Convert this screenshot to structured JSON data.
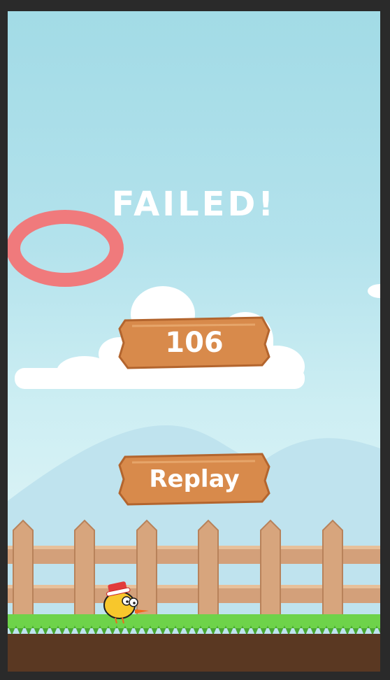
{
  "status": {
    "title": "FAILED!"
  },
  "score": {
    "value": "106"
  },
  "replay_button": {
    "label": "Replay"
  },
  "colors": {
    "sky_top": "#a2dbe6",
    "ring": "#f07a7c",
    "wood": "#d88a4b",
    "fence": "#d3a07a",
    "grass": "#6ed34a",
    "dirt": "#5a3822"
  },
  "icons": [
    "target-ring-icon",
    "bird-character-icon"
  ]
}
